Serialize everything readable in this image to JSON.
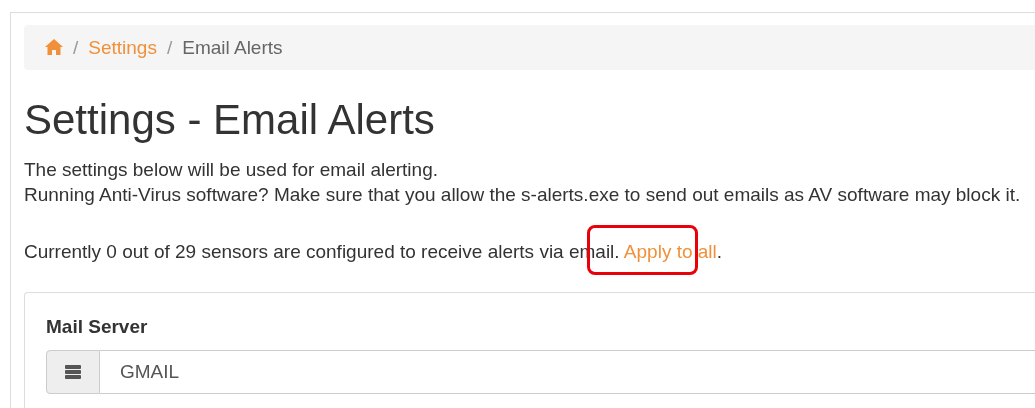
{
  "breadcrumb": [
    {
      "kind": "home"
    },
    {
      "kind": "separator",
      "label": "/"
    },
    {
      "kind": "link",
      "label": "Settings"
    },
    {
      "kind": "separator",
      "label": "/"
    },
    {
      "kind": "current",
      "label": "Email Alerts"
    }
  ],
  "title": "Settings - Email Alerts",
  "intro": [
    "The settings below will be used for email alerting.",
    "Running Anti-Virus software? Make sure that you allow the s-alerts.exe to send out emails as AV software may block it."
  ],
  "status": {
    "text_before": "Currently 0 out of 29 sensors are configured to receive alerts via email. ",
    "link": "Apply to all",
    "text_after": ".",
    "highlighted": true
  },
  "mail_server": {
    "label": "Mail Server",
    "value": "GMAIL"
  }
}
